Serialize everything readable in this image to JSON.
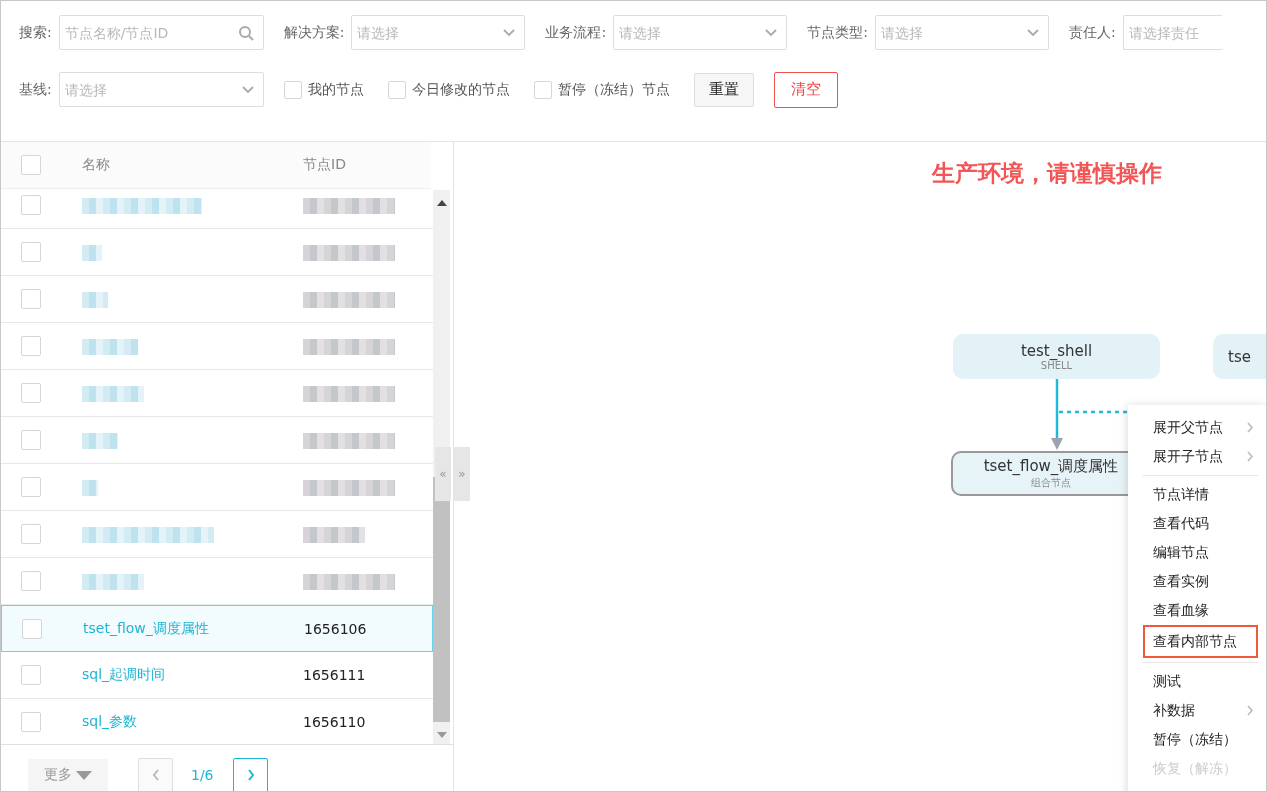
{
  "filters": {
    "row1": [
      {
        "kind": "search",
        "label": "搜索:",
        "placeholder": "节点名称/节点ID"
      },
      {
        "kind": "select",
        "label": "解决方案:",
        "placeholder": "请选择"
      },
      {
        "kind": "select",
        "label": "业务流程:",
        "placeholder": "请选择"
      },
      {
        "kind": "select",
        "label": "节点类型:",
        "placeholder": "请选择"
      },
      {
        "kind": "input",
        "label": "责任人:",
        "placeholder": "请选择责任"
      }
    ],
    "row2": [
      {
        "kind": "select",
        "label": "基线:",
        "placeholder": "请选择"
      }
    ],
    "options": [
      {
        "label": "我的节点",
        "checked": false
      },
      {
        "label": "今日修改的节点",
        "checked": false
      },
      {
        "label": "暂停（冻结）节点",
        "checked": false
      }
    ],
    "buttons": [
      {
        "label": "重置",
        "kind": "default"
      },
      {
        "label": "清空",
        "kind": "danger"
      }
    ]
  },
  "table": {
    "header_checked": false,
    "columns": [
      "名称",
      "节点ID"
    ],
    "rows": [
      {
        "kind": "redacted",
        "checked": false,
        "selected": false
      },
      {
        "kind": "redacted",
        "checked": false,
        "selected": false
      },
      {
        "kind": "redacted",
        "checked": false,
        "selected": false
      },
      {
        "kind": "redacted",
        "checked": false,
        "selected": false
      },
      {
        "kind": "redacted",
        "checked": false,
        "selected": false
      },
      {
        "kind": "redacted",
        "checked": false,
        "selected": false
      },
      {
        "kind": "redacted",
        "checked": false,
        "selected": false
      },
      {
        "kind": "redacted",
        "checked": false,
        "selected": false
      },
      {
        "kind": "redacted",
        "checked": false,
        "selected": false
      },
      {
        "kind": "text",
        "name": "tset_flow_调度属性",
        "id": "1656106",
        "checked": false,
        "selected": true
      },
      {
        "kind": "text",
        "name": "sql_起调时间",
        "id": "1656111",
        "checked": false,
        "selected": false
      },
      {
        "kind": "text",
        "name": "sql_参数",
        "id": "1656110",
        "checked": false,
        "selected": false
      }
    ]
  },
  "pagination": {
    "more": "更多",
    "page": "1/6"
  },
  "splitter": {
    "collapse": "«",
    "expand": "»"
  },
  "canvas": {
    "warning": "生产环境，请谨慎操作",
    "nodes": [
      {
        "name": "test_shell",
        "type": "SHELL",
        "selected": false
      },
      {
        "name": "tse",
        "selected": false
      },
      {
        "name": "tset_flow_调度属性",
        "type": "组合节点",
        "selected": true
      }
    ]
  },
  "context_menu": {
    "groups": [
      [
        {
          "label": "展开父节点",
          "submenu": true,
          "highlighted": false,
          "disabled": false
        },
        {
          "label": "展开子节点",
          "submenu": true,
          "highlighted": false,
          "disabled": false
        }
      ],
      [
        {
          "label": "节点详情",
          "submenu": false,
          "highlighted": false,
          "disabled": false
        },
        {
          "label": "查看代码",
          "submenu": false,
          "highlighted": false,
          "disabled": false
        },
        {
          "label": "编辑节点",
          "submenu": false,
          "highlighted": false,
          "disabled": false
        },
        {
          "label": "查看实例",
          "submenu": false,
          "highlighted": false,
          "disabled": false
        },
        {
          "label": "查看血缘",
          "submenu": false,
          "highlighted": false,
          "disabled": false
        },
        {
          "label": "查看内部节点",
          "submenu": false,
          "highlighted": true,
          "disabled": false
        }
      ],
      [
        {
          "label": "测试",
          "submenu": false,
          "highlighted": false,
          "disabled": false
        },
        {
          "label": "补数据",
          "submenu": true,
          "highlighted": false,
          "disabled": false
        },
        {
          "label": "暂停（冻结）",
          "submenu": false,
          "highlighted": false,
          "disabled": false
        },
        {
          "label": "恢复（解冻）",
          "submenu": false,
          "highlighted": false,
          "disabled": true
        }
      ]
    ]
  }
}
